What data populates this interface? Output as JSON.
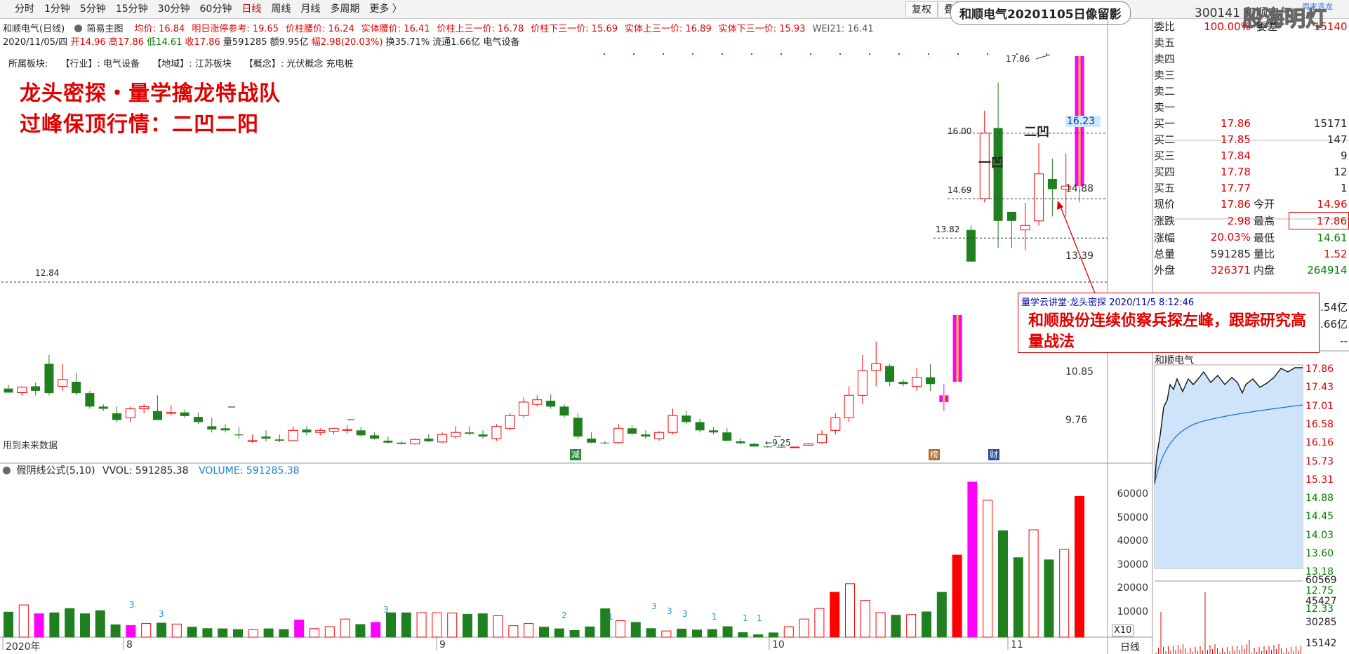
{
  "toolbar": {
    "tabs": [
      "分时",
      "1分钟",
      "5分钟",
      "15分钟",
      "30分钟",
      "60分钟",
      "日线",
      "周线",
      "月线",
      "多周期",
      "更多 〉"
    ],
    "active": "日线",
    "right_buttons": [
      "复权",
      "叠"
    ],
    "title_box": "和顺电气20201105日像留影",
    "stock_code_name": "300141 和顺电气",
    "watermark": "股海明灯",
    "overlay_tag": "周末选龙"
  },
  "header": {
    "line1": {
      "name": "和顺电气(日线)",
      "mode_icon": "gear-icon",
      "mode": "简易主图",
      "fields": [
        "均价: 16.84",
        "明日涨停参考: 19.65",
        "价柱腰价: 16.24",
        "实体腰价: 16.41",
        "价柱上三一价: 16.78",
        "价柱下三一价: 15.69",
        "实体上三一价: 16.89",
        "实体下三一价: 15.93",
        "WEI21: 16.41"
      ]
    },
    "line2": {
      "date": "2020/11/05/四",
      "open": "开14.96",
      "high": "高17.86",
      "low": "低14.61",
      "close": "收17.86",
      "vol": "量591285",
      "amt": "额9.95亿",
      "chg": "幅2.98(20.03%)",
      "turn": "换35.71%",
      "float": "流通1.66亿",
      "sector": "电气设备"
    },
    "line3": {
      "label": "所属板块:",
      "industry": "【行业】: 电气设备",
      "region": "【地域】: 江苏板块",
      "concept": "【概念】: 光伏概念 充电桩"
    }
  },
  "overlay": {
    "title1": "龙头密探・量学擒龙特战队",
    "title2": "过峰保顶行情：二凹二阳",
    "label_1": "一凹",
    "label_2": "二凹",
    "future_note": "用到未来数据"
  },
  "price_axis": {
    "labels": [
      "16.23",
      "14.88",
      "13.39",
      "10.85",
      "9.76"
    ],
    "current": "16.23"
  },
  "price_marks": [
    "17.86",
    "16.00",
    "14.69",
    "13.82",
    "12.84",
    "9.25"
  ],
  "events": {
    "reduce": "减",
    "rank": "榜",
    "finance": "财"
  },
  "callout": {
    "header": "量学云讲堂·龙头密探 2020/11/5 8:12:46",
    "body": "和顺股份连续侦察兵探左峰，跟踪研究高量战法"
  },
  "volume_panel": {
    "title_icon": "gear-icon",
    "title": "假阴线公式(5,10)",
    "vvol": "VVOL: 591285.38",
    "volume": "VOLUME: 591285.38",
    "axis": [
      "60000",
      "50000",
      "40000",
      "30000",
      "20000",
      "10000"
    ],
    "unit": "X10",
    "ann_numbers": [
      "3",
      "3",
      "3",
      "2",
      "1",
      "3",
      "3",
      "3",
      "1",
      "1",
      "1"
    ]
  },
  "time_axis": [
    "2020年",
    "8",
    "9",
    "10",
    "11"
  ],
  "quote": {
    "webi": {
      "label": "委比",
      "value": "100.00%",
      "label2": "委差",
      "value2": "15140"
    },
    "sell": [
      {
        "label": "卖五",
        "price": "",
        "vol": ""
      },
      {
        "label": "卖四",
        "price": "",
        "vol": ""
      },
      {
        "label": "卖三",
        "price": "",
        "vol": ""
      },
      {
        "label": "卖二",
        "price": "",
        "vol": ""
      },
      {
        "label": "卖一",
        "price": "",
        "vol": ""
      }
    ],
    "buy": [
      {
        "label": "买一",
        "price": "17.86",
        "vol": "15171"
      },
      {
        "label": "买二",
        "price": "17.85",
        "vol": "147"
      },
      {
        "label": "买三",
        "price": "17.84",
        "vol": "9"
      },
      {
        "label": "买四",
        "price": "17.78",
        "vol": "12"
      },
      {
        "label": "买五",
        "price": "17.77",
        "vol": "1"
      }
    ],
    "stats": [
      {
        "l1": "现价",
        "v1": "17.86",
        "c1": "red",
        "l2": "今开",
        "v2": "14.96",
        "c2": "red"
      },
      {
        "l1": "涨跌",
        "v1": "2.98",
        "c1": "red",
        "l2": "最高",
        "v2": "17.86",
        "c2": "red"
      },
      {
        "l1": "涨幅",
        "v1": "20.03%",
        "c1": "red",
        "l2": "最低",
        "v2": "14.61",
        "c2": "green"
      },
      {
        "l1": "总量",
        "v1": "591285",
        "c1": "",
        "l2": "量比",
        "v2": "1.52",
        "c2": "red"
      },
      {
        "l1": "外盘",
        "v1": "326371",
        "c1": "red",
        "l2": "内盘",
        "v2": "264914",
        "c2": "green"
      }
    ],
    "partial_right": [
      ".54亿",
      ".66亿",
      "--"
    ]
  },
  "intraday": {
    "name": "和顺电气",
    "price_axis": [
      "17.86",
      "17.43",
      "17.01",
      "16.58",
      "16.16",
      "15.73",
      "15.31",
      "14.88",
      "14.45",
      "14.03",
      "13.60",
      "13.18",
      "12.75",
      "12.33"
    ],
    "vol_axis": [
      "60569",
      "45427",
      "30285",
      "15142"
    ],
    "footer": "日线"
  },
  "chart_data": {
    "type": "candlestick",
    "ohlc": [
      [
        10.45,
        10.53,
        10.36,
        10.36
      ],
      [
        10.36,
        10.5,
        10.29,
        10.48
      ],
      [
        10.5,
        10.58,
        10.3,
        10.4
      ],
      [
        11.0,
        11.2,
        10.3,
        10.35
      ],
      [
        10.5,
        11.0,
        10.4,
        10.65
      ],
      [
        10.6,
        10.8,
        10.3,
        10.35
      ],
      [
        10.35,
        10.4,
        10.0,
        10.05
      ],
      [
        10.05,
        10.1,
        9.95,
        10.0
      ],
      [
        9.9,
        10.05,
        9.7,
        9.75
      ],
      [
        9.8,
        10.05,
        9.7,
        10.0
      ],
      [
        10.0,
        10.1,
        9.9,
        10.05
      ],
      [
        9.95,
        10.3,
        9.8,
        9.75
      ],
      [
        9.9,
        10.08,
        9.85,
        9.92
      ],
      [
        9.92,
        9.98,
        9.8,
        9.84
      ],
      [
        9.82,
        9.92,
        9.65,
        9.7
      ],
      [
        9.6,
        9.8,
        9.45,
        9.52
      ],
      [
        9.55,
        9.65,
        9.45,
        9.5
      ],
      [
        9.4,
        9.58,
        9.3,
        9.38
      ],
      [
        9.2,
        9.4,
        9.1,
        9.25
      ],
      [
        9.35,
        9.5,
        9.2,
        9.3
      ],
      [
        9.28,
        9.4,
        9.15,
        9.25
      ],
      [
        9.25,
        9.6,
        9.2,
        9.5
      ],
      [
        9.52,
        9.6,
        9.38,
        9.45
      ],
      [
        9.45,
        9.55,
        9.38,
        9.5
      ],
      [
        9.48,
        9.56,
        9.4,
        9.55
      ],
      [
        9.5,
        9.62,
        9.42,
        9.52
      ],
      [
        9.5,
        9.58,
        9.35,
        9.38
      ],
      [
        9.38,
        9.45,
        9.28,
        9.3
      ],
      [
        9.25,
        9.35,
        9.05,
        9.1
      ],
      [
        9.1,
        9.2,
        8.95,
        9.0
      ],
      [
        9.0,
        9.3,
        8.95,
        9.28
      ],
      [
        9.3,
        9.4,
        9.15,
        9.2
      ],
      [
        9.15,
        9.45,
        9.1,
        9.4
      ],
      [
        9.35,
        9.6,
        9.3,
        9.45
      ],
      [
        9.45,
        9.6,
        9.38,
        9.42
      ],
      [
        9.4,
        9.5,
        9.3,
        9.35
      ],
      [
        9.3,
        9.65,
        9.25,
        9.6
      ],
      [
        9.55,
        9.9,
        9.5,
        9.85
      ],
      [
        9.85,
        10.25,
        9.8,
        10.15
      ],
      [
        10.1,
        10.3,
        10.05,
        10.2
      ],
      [
        10.18,
        10.32,
        10.0,
        10.05
      ],
      [
        10.05,
        10.1,
        9.8,
        9.85
      ],
      [
        9.8,
        9.9,
        9.3,
        9.35
      ],
      [
        9.3,
        9.45,
        9.05,
        9.1
      ],
      [
        9.1,
        9.2,
        8.98,
        9.05
      ],
      [
        9.1,
        9.65,
        9.05,
        9.55
      ],
      [
        9.55,
        9.62,
        9.4,
        9.42
      ],
      [
        9.4,
        9.5,
        9.3,
        9.35
      ],
      [
        9.3,
        9.48,
        9.25,
        9.45
      ],
      [
        9.45,
        10.0,
        9.4,
        9.85
      ],
      [
        9.85,
        9.95,
        9.65,
        9.7
      ],
      [
        9.7,
        9.78,
        9.45,
        9.5
      ],
      [
        9.5,
        9.58,
        9.4,
        9.45
      ],
      [
        9.45,
        9.55,
        9.2,
        9.25
      ],
      [
        9.2,
        9.3,
        8.98,
        9.05
      ],
      [
        9.0,
        9.1,
        8.78,
        8.8
      ],
      [
        8.8,
        8.85,
        8.72,
        8.75
      ],
      [
        8.78,
        8.82,
        8.7,
        8.75
      ],
      [
        8.75,
        8.8,
        8.7,
        8.76
      ],
      [
        8.9,
        9.05,
        8.85,
        9.0
      ],
      [
        9.1,
        9.5,
        9.0,
        9.4
      ],
      [
        9.5,
        9.9,
        9.4,
        9.8
      ],
      [
        9.8,
        10.5,
        9.7,
        10.3
      ],
      [
        10.3,
        11.2,
        10.1,
        10.85
      ],
      [
        10.85,
        11.5,
        10.5,
        11.0
      ],
      [
        10.95,
        11.0,
        10.5,
        10.6
      ],
      [
        10.6,
        10.65,
        10.5,
        10.55
      ],
      [
        10.5,
        10.9,
        10.4,
        10.7
      ],
      [
        10.7,
        11.0,
        10.4,
        10.55
      ],
      [
        10.3,
        10.55,
        9.95,
        10.15
      ],
      [
        10.6,
        12.1,
        10.6,
        12.1
      ],
      [
        14.0,
        14.1,
        13.3,
        13.3
      ],
      [
        14.69,
        16.5,
        14.61,
        16.0
      ],
      [
        16.1,
        17.2,
        13.6,
        14.2
      ],
      [
        14.4,
        14.4,
        13.6,
        14.2
      ],
      [
        14.0,
        14.6,
        13.55,
        14.1
      ],
      [
        14.2,
        15.8,
        14.1,
        15.2
      ],
      [
        15.1,
        15.5,
        14.3,
        14.9
      ],
      [
        14.9,
        15.6,
        14.3,
        14.96
      ],
      [
        14.96,
        17.86,
        14.61,
        17.86
      ]
    ],
    "volume_x10": [
      10500,
      13500,
      9800,
      10200,
      12000,
      9800,
      11100,
      5200,
      4900,
      5700,
      5900,
      5500,
      4200,
      3600,
      3500,
      3200,
      3100,
      3500,
      3200,
      7200,
      3600,
      4400,
      7600,
      5300,
      6200,
      10200,
      10200,
      10300,
      10200,
      10100,
      9600,
      9800,
      9000,
      4800,
      5700,
      4200,
      3500,
      2800,
      4300,
      11900,
      6900,
      6200,
      3600,
      2600,
      3400,
      3000,
      3200,
      4400,
      1900,
      1000,
      1800,
      4400,
      7600,
      12000,
      18800,
      22400,
      15400,
      10300,
      9200,
      9500,
      10600,
      18800,
      34400,
      65000,
      57400,
      44600,
      33300,
      45000,
      32400,
      36800,
      59000
    ],
    "ylim": [
      8.6,
      18.0
    ]
  },
  "colors": {
    "up": "#ff0000",
    "down": "#208020",
    "limit": "#ff00ff",
    "limit_center": "#ffd700",
    "dashed": "#333333"
  }
}
